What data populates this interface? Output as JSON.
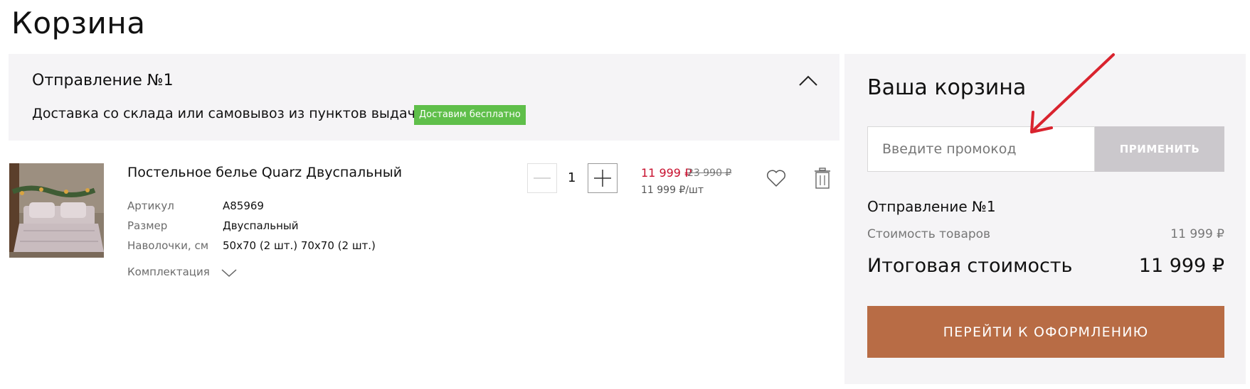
{
  "page": {
    "title": "Корзина"
  },
  "shipment": {
    "title": "Отправление №1",
    "description": "Доставка со склада или самовывоз из пунктов выдачи",
    "badge": "Доставим бесплатно"
  },
  "product": {
    "name": "Постельное белье Quarz Двуспальный",
    "attributes": [
      {
        "label": "Артикул",
        "value": "A85969"
      },
      {
        "label": "Размер",
        "value": "Двуспальный"
      },
      {
        "label": "Наволочки, см",
        "value": "50х70 (2 шт.) 70х70 (2 шт.)"
      }
    ],
    "completeness_label": "Комплектация",
    "quantity": "1",
    "price": "11 999 ₽",
    "old_price": "23 990 ₽",
    "unit_price": "11 999 ₽/шт"
  },
  "summary": {
    "title": "Ваша корзина",
    "promo_placeholder": "Введите промокод",
    "promo_apply": "ПРИМЕНИТЬ",
    "shipment_title": "Отправление №1",
    "goods_label": "Стоимость товаров",
    "goods_value": "11 999 ₽",
    "total_label": "Итоговая стоимость",
    "total_value": "11 999 ₽",
    "checkout": "ПЕРЕЙТИ К ОФОРМЛЕНИЮ"
  },
  "colors": {
    "accent": "#b86c45",
    "badge": "#5fbf4a",
    "price": "#c8102e",
    "panel": "#f5f4f6"
  },
  "icons": [
    "chevron-up-icon",
    "minus-icon",
    "plus-icon",
    "heart-icon",
    "trash-icon",
    "chevron-down-icon",
    "annotation-arrow"
  ]
}
